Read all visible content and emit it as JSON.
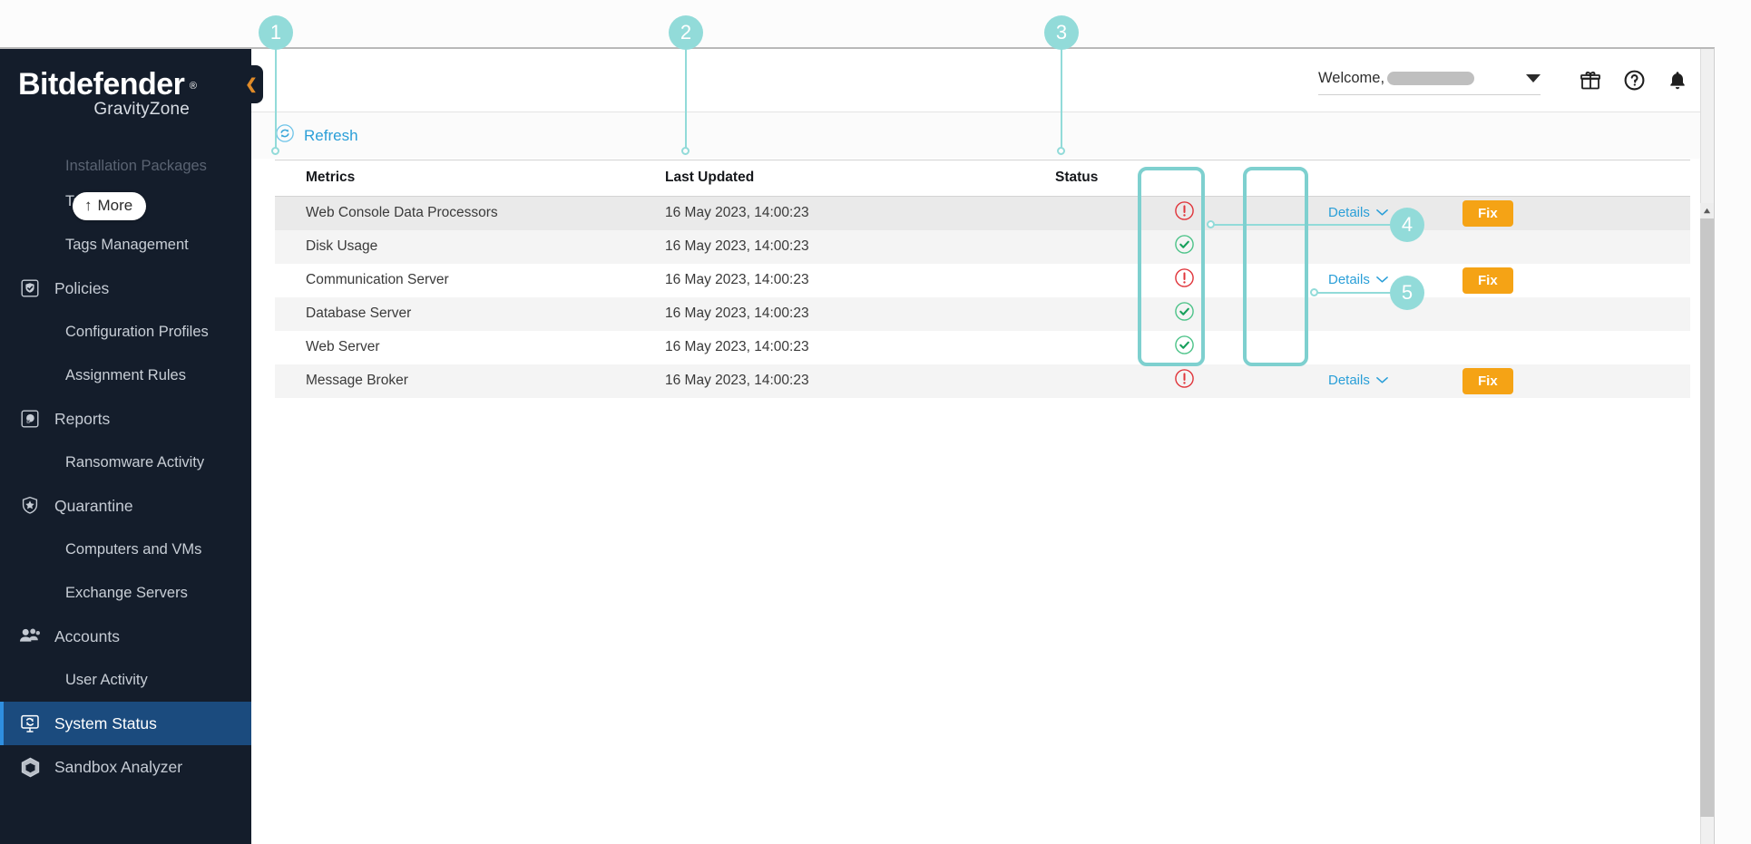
{
  "brand": {
    "name": "Bitdefender",
    "reg": "®",
    "product": "GravityZone"
  },
  "sidebar": {
    "more_label": "More",
    "more_arrow": "↑",
    "collapse_icon": "chevron-left-icon",
    "collapse_glyph": "❮",
    "items": [
      {
        "label": "Installation Packages",
        "level": "sub",
        "icon": "",
        "active": false
      },
      {
        "label": "Tasks",
        "level": "sub",
        "icon": "",
        "active": false
      },
      {
        "label": "Tags Management",
        "level": "sub",
        "icon": "",
        "active": false
      },
      {
        "label": "Policies",
        "level": "top",
        "icon": "policy-shield-icon",
        "active": false
      },
      {
        "label": "Configuration Profiles",
        "level": "sub",
        "icon": "",
        "active": false
      },
      {
        "label": "Assignment Rules",
        "level": "sub",
        "icon": "",
        "active": false
      },
      {
        "label": "Reports",
        "level": "top",
        "icon": "reports-icon",
        "active": false
      },
      {
        "label": "Ransomware Activity",
        "level": "sub",
        "icon": "",
        "active": false
      },
      {
        "label": "Quarantine",
        "level": "top",
        "icon": "quarantine-shield-icon",
        "active": false
      },
      {
        "label": "Computers and VMs",
        "level": "sub",
        "icon": "",
        "active": false
      },
      {
        "label": "Exchange Servers",
        "level": "sub",
        "icon": "",
        "active": false
      },
      {
        "label": "Accounts",
        "level": "top",
        "icon": "accounts-people-icon",
        "active": false
      },
      {
        "label": "User Activity",
        "level": "sub",
        "icon": "",
        "active": false
      },
      {
        "label": "System Status",
        "level": "top",
        "icon": "system-status-icon",
        "active": true
      },
      {
        "label": "Sandbox Analyzer",
        "level": "top",
        "icon": "sandbox-box-icon",
        "active": false
      }
    ]
  },
  "topbar": {
    "welcome_label": "Welcome,",
    "user_redacted": true,
    "dropdown_icon": "caret-down-icon",
    "icons": [
      {
        "name": "gift-icon"
      },
      {
        "name": "help-question-icon"
      },
      {
        "name": "notifications-bell-icon"
      }
    ]
  },
  "toolbar": {
    "refresh_label": "Refresh",
    "refresh_icon": "refresh-circle-icon"
  },
  "table": {
    "columns": [
      "Metrics",
      "Last Updated",
      "Status",
      "",
      "",
      ""
    ],
    "rows": [
      {
        "metric": "Web Console Data Processors",
        "updated": "16 May 2023, 14:00:23",
        "status": "error",
        "details": "Details",
        "fix": "Fix"
      },
      {
        "metric": "Disk Usage",
        "updated": "16 May 2023, 14:00:23",
        "status": "ok",
        "details": "",
        "fix": ""
      },
      {
        "metric": "Communication Server",
        "updated": "16 May 2023, 14:00:23",
        "status": "error",
        "details": "Details",
        "fix": "Fix"
      },
      {
        "metric": "Database Server",
        "updated": "16 May 2023, 14:00:23",
        "status": "ok",
        "details": "",
        "fix": ""
      },
      {
        "metric": "Web Server",
        "updated": "16 May 2023, 14:00:23",
        "status": "ok",
        "details": "",
        "fix": ""
      },
      {
        "metric": "Message Broker",
        "updated": "16 May 2023, 14:00:23",
        "status": "error",
        "details": "Details",
        "fix": "Fix"
      }
    ]
  },
  "callouts": [
    {
      "number": "1"
    },
    {
      "number": "2"
    },
    {
      "number": "3"
    },
    {
      "number": "4"
    },
    {
      "number": "5"
    }
  ],
  "colors": {
    "accent_teal": "#92dbd9",
    "highlight_border": "#7ed0cf",
    "link_blue": "#2a9fd8",
    "fix_orange": "#f5a315",
    "status_error_red": "#e0363c",
    "status_ok_green": "#2bb673",
    "sidebar_bg": "#141d2b",
    "active_item_bg": "#1b4b7e"
  }
}
